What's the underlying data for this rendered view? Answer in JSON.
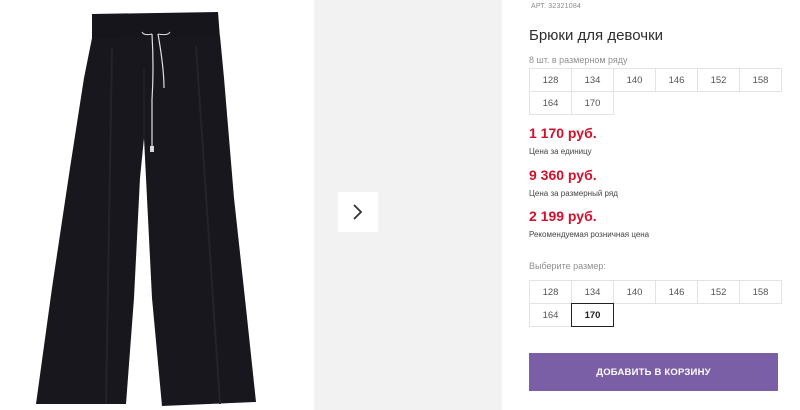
{
  "product": {
    "sku_label": "АРТ.",
    "sku": "32321084",
    "title": "Брюки для девочки",
    "image_alt_icon": "black-wide-leg-pants"
  },
  "gallery": {
    "next_icon": "chevron-right-icon"
  },
  "pack": {
    "note": "8 шт. в размерном ряду",
    "sizes": [
      "128",
      "134",
      "140",
      "146",
      "152",
      "158",
      "164",
      "170"
    ]
  },
  "prices": {
    "unit_price": "1 170 руб.",
    "unit_label": "Цена за единицу",
    "pack_price": "9 360 руб.",
    "pack_label": "Цена за размерный ряд",
    "retail_price": "2 199 руб.",
    "retail_label": "Рекомендуемая розничная цена",
    "price_color": "#d3102b"
  },
  "size_picker": {
    "label": "Выберите размер:",
    "sizes": [
      "128",
      "134",
      "140",
      "146",
      "152",
      "158",
      "164",
      "170"
    ],
    "selected": "170"
  },
  "cart": {
    "button_label": "ДОБАВИТЬ В КОРЗИНУ",
    "button_color": "#7b5fa6"
  }
}
